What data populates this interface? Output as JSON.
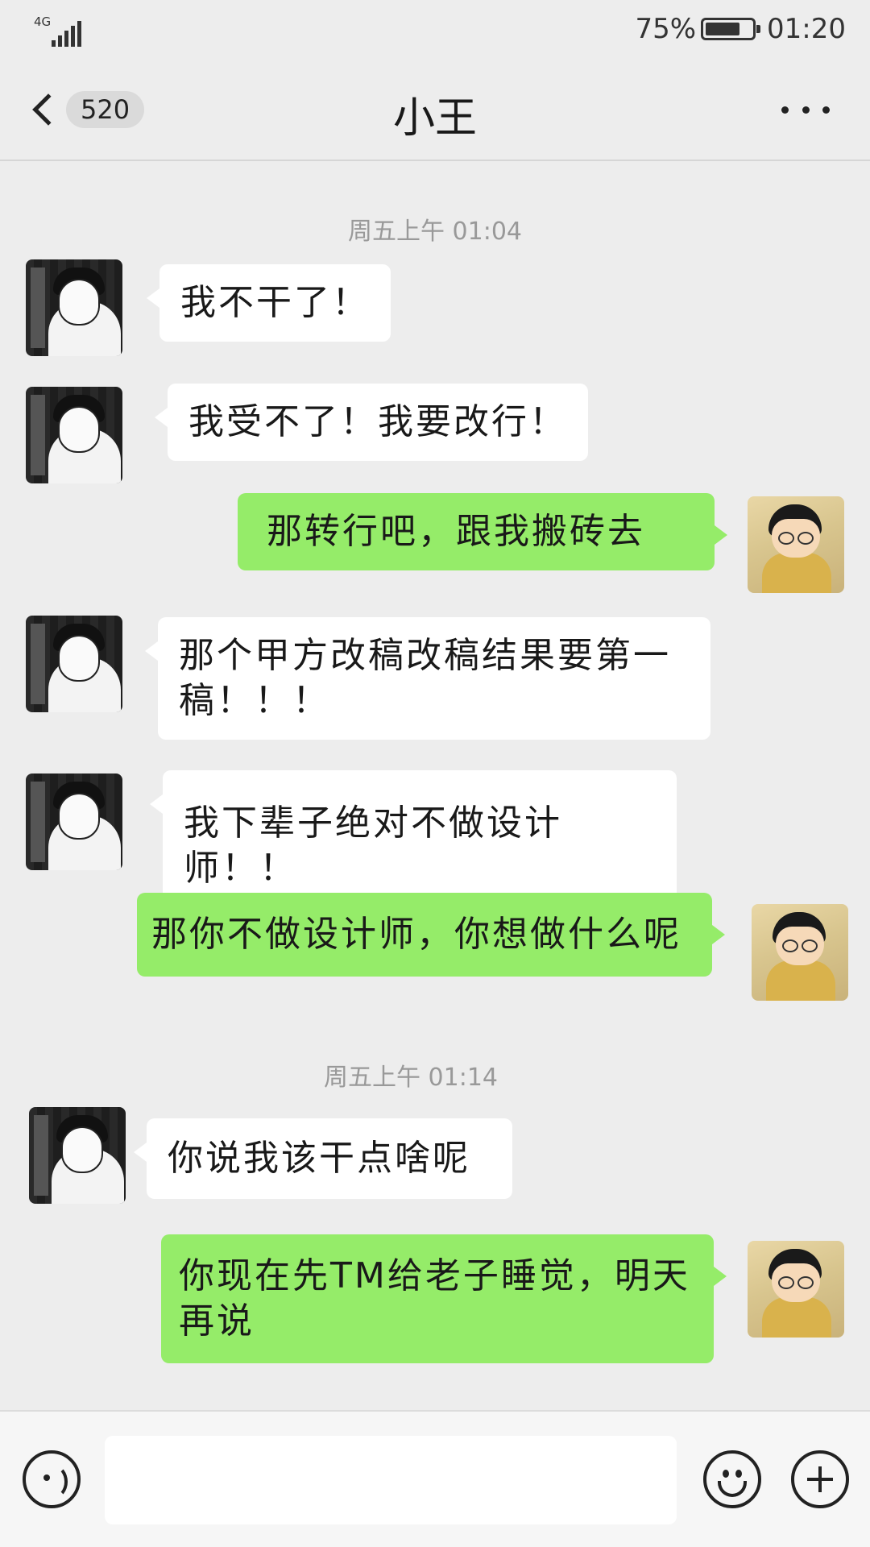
{
  "status_bar": {
    "network": "4G",
    "battery_percent": "75%",
    "battery_level": 0.75,
    "time": "01:20"
  },
  "nav": {
    "back_count": "520",
    "title": "小王",
    "back_icon": "chevron-left-icon",
    "more_icon": "more-dots-icon"
  },
  "messages": {
    "timestamp_1": "周五上午 01:04",
    "msg_1": "我不干了！",
    "msg_2": "我受不了！我要改行！",
    "msg_3": "那转行吧，跟我搬砖去",
    "msg_4": "那个甲方改稿改稿结果要第一稿！！！",
    "msg_5": "我下辈子绝对不做设计师！！",
    "msg_6": "那你不做设计师，你想做什么呢",
    "timestamp_2": "周五上午 01:14",
    "msg_7": "你说我该干点啥呢",
    "msg_8": "你现在先TM给老子睡觉，明天再说"
  },
  "input_bar": {
    "placeholder": "",
    "voice_icon": "voice-icon",
    "emoji_icon": "emoji-icon",
    "plus_icon": "plus-icon"
  },
  "colors": {
    "background": "#ededed",
    "incoming_bubble": "#ffffff",
    "outgoing_bubble": "#95ec69"
  }
}
